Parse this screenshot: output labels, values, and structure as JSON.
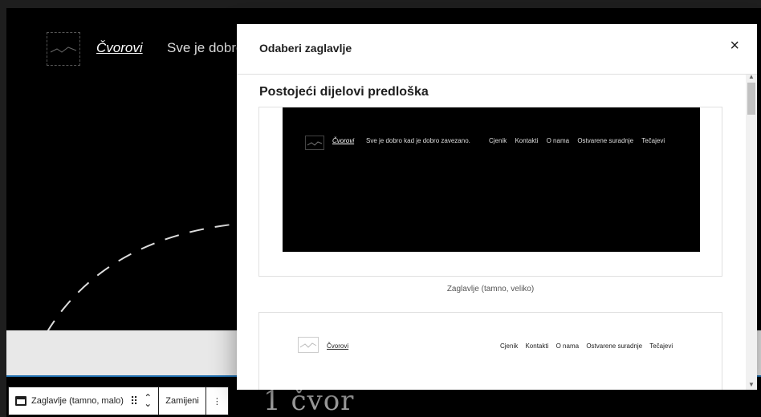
{
  "canvas": {
    "site_title": "Čvorovi",
    "site_tagline": "Sve je dobro",
    "below_text": "1 čvor"
  },
  "toolbar": {
    "block_label": "Zaglavlje (tamno, malo)",
    "replace_label": "Zamijeni",
    "more_label": "⋮"
  },
  "modal": {
    "title": "Odaberi zaglavlje",
    "close_label": "×",
    "section_title": "Postojeći dijelovi predloška",
    "pattern1": {
      "site_title": "Čvorovi",
      "tagline": "Sve je dobro kad je dobro zavezano.",
      "nav": [
        "Cjenik",
        "Kontakti",
        "O nama",
        "Ostvarene suradnje",
        "Tečajevi"
      ],
      "label": "Zaglavlje (tamno, veliko)"
    },
    "pattern2": {
      "site_title": "Čvorovi",
      "nav": [
        "Cjenik",
        "Kontakti",
        "O nama",
        "Ostvarene suradnje",
        "Tečajevi"
      ]
    }
  }
}
